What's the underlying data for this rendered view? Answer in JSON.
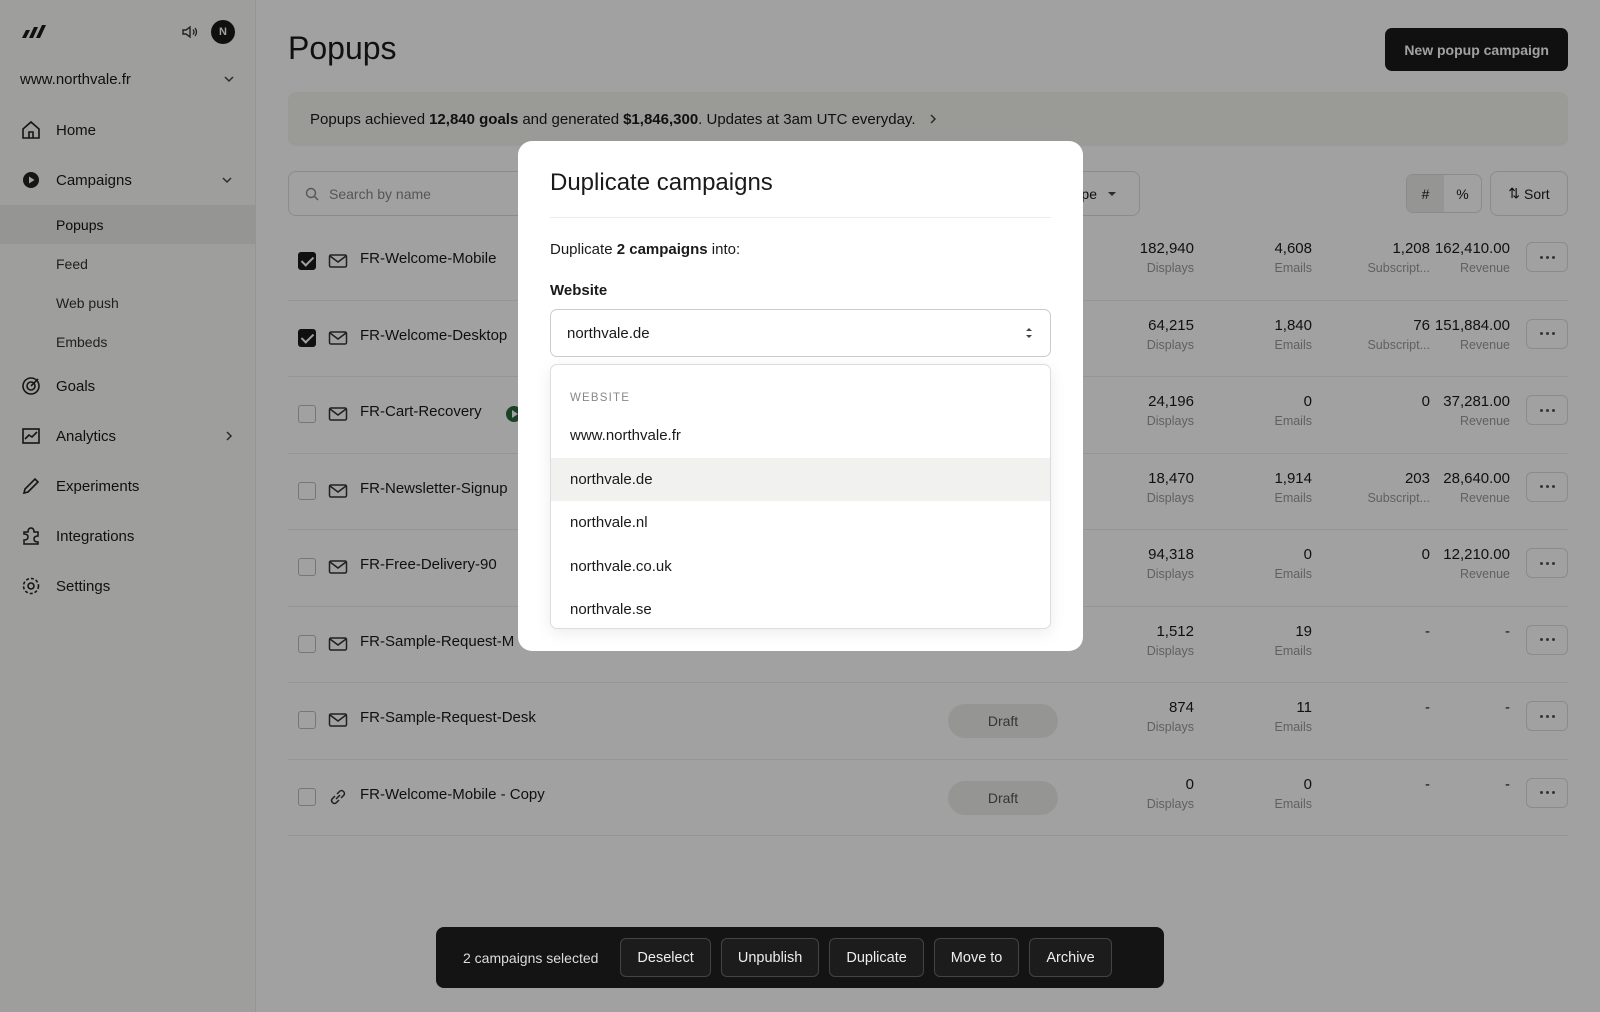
{
  "sidebar": {
    "avatar_initial": "N",
    "site": "www.northvale.fr",
    "nav": [
      {
        "label": "Home",
        "icon": "home-icon"
      },
      {
        "label": "Campaigns",
        "icon": "play-circle-icon"
      },
      {
        "label": "Goals",
        "icon": "target-icon"
      },
      {
        "label": "Analytics",
        "icon": "chart-icon"
      },
      {
        "label": "Experiments",
        "icon": "pencil-icon"
      },
      {
        "label": "Integrations",
        "icon": "puzzle-icon"
      },
      {
        "label": "Settings",
        "icon": "gear-icon"
      }
    ],
    "campaign_subitems": [
      "Popups",
      "Feed",
      "Web push",
      "Embeds"
    ]
  },
  "header": {
    "title": "Popups",
    "new_button": "New popup campaign"
  },
  "banner": {
    "p1": "Popups achieved",
    "goals": "12,840 goals",
    "p2": "and generated",
    "revenue": "$1,846,300",
    "p3": ". Updates at 3am UTC everyday."
  },
  "toolbar": {
    "search_placeholder": "Search by name",
    "type_filter": "pe",
    "toggle_count": "#",
    "toggle_percent": "%",
    "sort": "Sort"
  },
  "rows": [
    {
      "name": "FR-Welcome-Mobile",
      "checked": true,
      "icon": "mail-icon",
      "status": "",
      "displays": "182,940",
      "emails": "4,608",
      "subs": "1,208",
      "subs_label": "Subscript...",
      "revenue": "162,410.00",
      "revenue_label": "Revenue"
    },
    {
      "name": "FR-Welcome-Desktop",
      "checked": true,
      "icon": "mail-icon",
      "status": "",
      "displays": "64,215",
      "emails": "1,840",
      "subs": "76",
      "subs_label": "Subscript...",
      "revenue": "151,884.00",
      "revenue_label": "Revenue"
    },
    {
      "name": "FR-Cart-Recovery",
      "checked": false,
      "icon": "mail-icon",
      "status": "",
      "live": true,
      "displays": "24,196",
      "emails": "0",
      "subs": "0",
      "subs_label": "",
      "revenue": "37,281.00",
      "revenue_label": "Revenue"
    },
    {
      "name": "FR-Newsletter-Signup",
      "checked": false,
      "icon": "mail-icon",
      "status": "",
      "displays": "18,470",
      "emails": "1,914",
      "subs": "203",
      "subs_label": "Subscript...",
      "revenue": "28,640.00",
      "revenue_label": "Revenue"
    },
    {
      "name": "FR-Free-Delivery-90",
      "checked": false,
      "icon": "mail-icon",
      "status": "",
      "displays": "94,318",
      "emails": "0",
      "subs": "0",
      "subs_label": "",
      "revenue": "12,210.00",
      "revenue_label": "Revenue"
    },
    {
      "name": "FR-Sample-Request-M",
      "checked": false,
      "icon": "mail-icon",
      "status": "",
      "displays": "1,512",
      "emails": "19",
      "subs": "-",
      "subs_label": "",
      "revenue": "-",
      "revenue_label": ""
    },
    {
      "name": "FR-Sample-Request-Desk",
      "checked": false,
      "icon": "mail-icon",
      "status": "Draft",
      "displays": "874",
      "emails": "11",
      "subs": "-",
      "subs_label": "",
      "revenue": "-",
      "revenue_label": ""
    },
    {
      "name": "FR-Welcome-Mobile - Copy",
      "checked": false,
      "icon": "link-icon",
      "status": "Draft",
      "displays": "0",
      "emails": "0",
      "subs": "-",
      "subs_label": "",
      "revenue": "-",
      "revenue_label": ""
    }
  ],
  "labels": {
    "displays": "Displays",
    "emails": "Emails"
  },
  "modal": {
    "title": "Duplicate campaigns",
    "desc_pre": "Duplicate",
    "desc_count": "2 campaigns",
    "desc_post": "into:",
    "field_label": "Website",
    "selected": "northvale.de",
    "dropdown_header": "WEBSITE",
    "options": [
      "www.northvale.fr",
      "northvale.de",
      "northvale.nl",
      "northvale.co.uk",
      "northvale.se"
    ]
  },
  "bulk": {
    "count": "2 campaigns selected",
    "deselect": "Deselect",
    "unpublish": "Unpublish",
    "duplicate": "Duplicate",
    "move": "Move to",
    "archive": "Archive"
  }
}
